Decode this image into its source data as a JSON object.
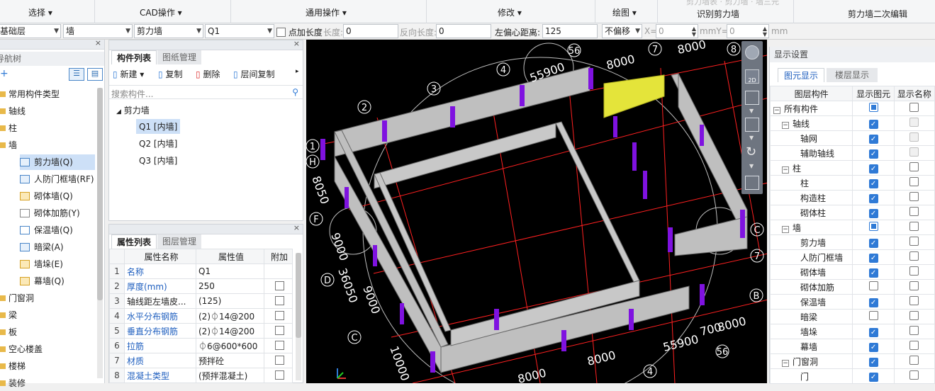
{
  "ribbon": {
    "groups": [
      "选择",
      "CAD操作",
      "通用操作",
      "修改",
      "绘图",
      "识别剪力墙",
      "剪力墙二次编辑"
    ],
    "faint_text": "剪力墙表 · 剪力墙 · 墙三元"
  },
  "options": {
    "floor": "基础层",
    "category": "墙",
    "type": "剪力墙",
    "component": "Q1",
    "point_length_label": "点加长度",
    "length_label": "长度:",
    "length_value": "0",
    "reverse_length_label": "反向长度:",
    "reverse_length_value": "0",
    "left_offset_label": "左偏心距离:",
    "left_offset_value": "125",
    "offset_mode": "不偏移",
    "x_label": "X=",
    "x_value": "0",
    "x_unit": "mm",
    "y_label": "Y=",
    "y_value": "0",
    "y_unit": "mm"
  },
  "nav": {
    "title": "导航树",
    "items": [
      "常用构件类型",
      "轴线",
      "柱",
      "墙",
      "剪力墙(Q)",
      "人防门框墙(RF)",
      "砌体墙(Q)",
      "砌体加筋(Y)",
      "保温墙(Q)",
      "暗梁(A)",
      "墙垛(E)",
      "幕墙(Q)",
      "门窗洞",
      "梁",
      "板",
      "空心楼盖",
      "楼梯",
      "装修"
    ]
  },
  "components": {
    "tabs": [
      "构件列表",
      "图纸管理"
    ],
    "new_label": "新建",
    "copy_label": "复制",
    "delete_label": "删除",
    "floor_copy_label": "层间复制",
    "search_placeholder": "搜索构件...",
    "group": "剪力墙",
    "items": [
      "Q1 [内墙]",
      "Q2 [内墙]",
      "Q3 [内墙]"
    ]
  },
  "attributes": {
    "tabs": [
      "属性列表",
      "图层管理"
    ],
    "headers": [
      "属性名称",
      "属性值",
      "附加"
    ],
    "rows": [
      {
        "no": "1",
        "name": "名称",
        "value": "Q1"
      },
      {
        "no": "2",
        "name": "厚度(mm)",
        "value": "250"
      },
      {
        "no": "3",
        "name": "轴线距左墙皮...",
        "value": "(125)"
      },
      {
        "no": "4",
        "name": "水平分布钢筋",
        "value": "(2)⏀14@200"
      },
      {
        "no": "5",
        "name": "垂直分布钢筋",
        "value": "(2)⏀14@200"
      },
      {
        "no": "6",
        "name": "拉筋",
        "value": "⏀6@600*600"
      },
      {
        "no": "7",
        "name": "材质",
        "value": "预拌砼"
      },
      {
        "no": "8",
        "name": "混凝土类型",
        "value": "(预拌混凝土)"
      }
    ]
  },
  "viewport": {
    "axis_labels": [
      "56",
      "7",
      "8",
      "4",
      "3",
      "2",
      "1",
      "H",
      "F",
      "D",
      "C",
      "C",
      "B",
      "7",
      "56",
      "4"
    ],
    "dims": [
      "55900",
      "8000",
      "8000",
      "8050",
      "9000",
      "36050",
      "9000",
      "10000",
      "8000",
      "8000",
      "55900",
      "700",
      "8000"
    ],
    "wall_color": "#c8c8c8",
    "grid_color": "#ff2020",
    "column_color": "#7f12e0",
    "selected_color": "#e4e43a"
  },
  "display": {
    "title": "显示设置",
    "tabs": [
      "图元显示",
      "楼层显示"
    ],
    "headers": [
      "图层构件",
      "显示图元",
      "显示名称"
    ],
    "rows": [
      {
        "name": "所有构件",
        "level": 0,
        "show": "partial",
        "name_show": "off"
      },
      {
        "name": "轴线",
        "level": 1,
        "show": "on",
        "name_show": "disabled"
      },
      {
        "name": "轴网",
        "level": 2,
        "show": "on",
        "name_show": "disabled"
      },
      {
        "name": "辅助轴线",
        "level": 2,
        "show": "on",
        "name_show": "disabled"
      },
      {
        "name": "柱",
        "level": 1,
        "show": "on",
        "name_show": "off"
      },
      {
        "name": "柱",
        "level": 2,
        "show": "on",
        "name_show": "off"
      },
      {
        "name": "构造柱",
        "level": 2,
        "show": "on",
        "name_show": "off"
      },
      {
        "name": "砌体柱",
        "level": 2,
        "show": "on",
        "name_show": "off"
      },
      {
        "name": "墙",
        "level": 1,
        "show": "partial",
        "name_show": "off"
      },
      {
        "name": "剪力墙",
        "level": 2,
        "show": "on",
        "name_show": "off"
      },
      {
        "name": "人防门框墙",
        "level": 2,
        "show": "on",
        "name_show": "off"
      },
      {
        "name": "砌体墙",
        "level": 2,
        "show": "on",
        "name_show": "off"
      },
      {
        "name": "砌体加筋",
        "level": 2,
        "show": "off",
        "name_show": "off"
      },
      {
        "name": "保温墙",
        "level": 2,
        "show": "on",
        "name_show": "off"
      },
      {
        "name": "暗梁",
        "level": 2,
        "show": "off",
        "name_show": "off"
      },
      {
        "name": "墙垛",
        "level": 2,
        "show": "on",
        "name_show": "off"
      },
      {
        "name": "幕墙",
        "level": 2,
        "show": "on",
        "name_show": "off"
      },
      {
        "name": "门窗洞",
        "level": 1,
        "show": "on",
        "name_show": "off"
      },
      {
        "name": "门",
        "level": 2,
        "show": "on",
        "name_show": "off"
      }
    ]
  }
}
